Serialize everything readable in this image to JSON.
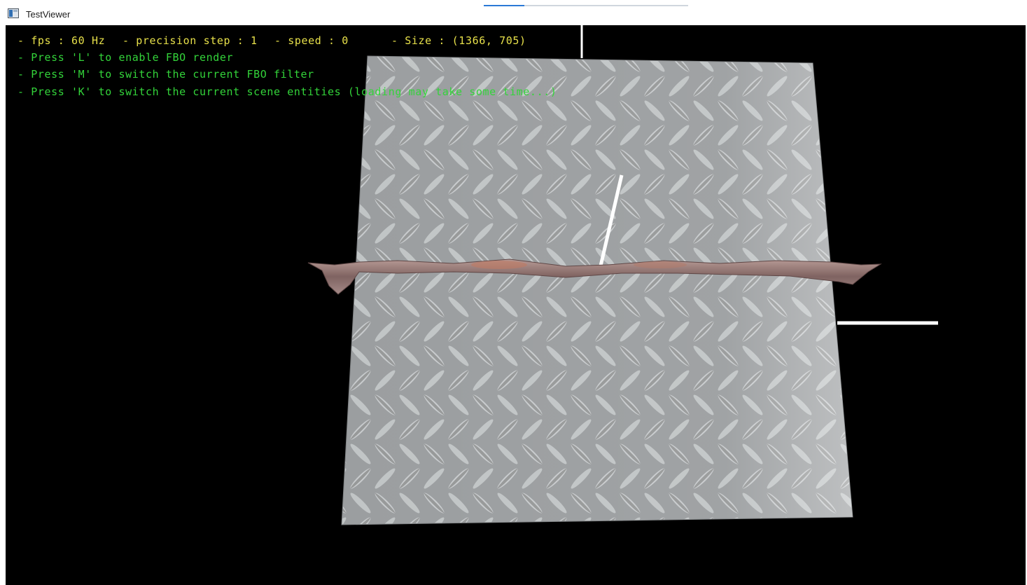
{
  "window": {
    "title": "TestViewer",
    "icon": "app-window-icon",
    "loading_progress": 0.2
  },
  "hud": {
    "fps": "- fps : 60 Hz",
    "precision": "- precision step : 1",
    "speed": "- speed : 0",
    "size": "- Size : (1366, 705)",
    "hint_l": "- Press 'L' to enable FBO render",
    "hint_m": "- Press 'M' to switch the current FBO filter",
    "hint_k": "- Press 'K' to switch the current scene entities (loading may take some time...)"
  },
  "colors": {
    "hud_stats": "#e7e04a",
    "hud_hints": "#33d43a",
    "background": "#000000",
    "plate": "#9a9d9f",
    "ribbon": "#8a6e6c",
    "axis": "#ffffff"
  }
}
